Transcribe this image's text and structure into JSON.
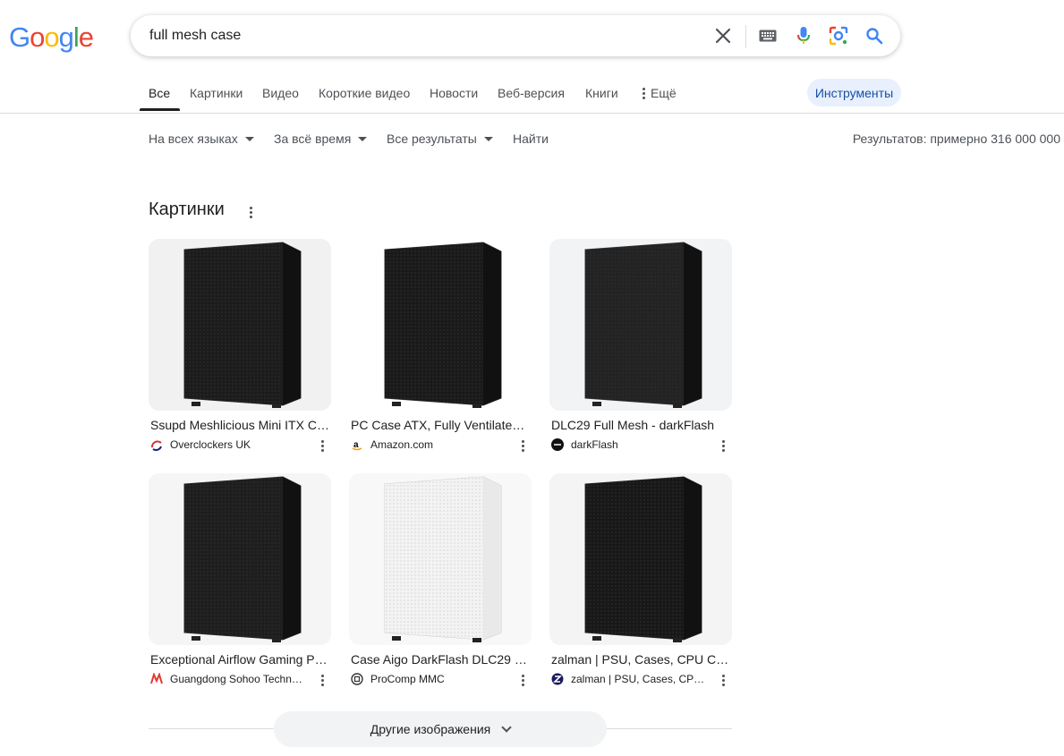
{
  "logo": {
    "letters": [
      "G",
      "o",
      "o",
      "g",
      "l",
      "e"
    ],
    "colors": [
      "#4285f4",
      "#ea4335",
      "#fbbc05",
      "#4285f4",
      "#34a853",
      "#ea4335"
    ]
  },
  "search": {
    "query": "full mesh case",
    "icons": [
      "clear-icon",
      "keyboard-icon",
      "microphone-icon",
      "lens-icon",
      "search-icon"
    ]
  },
  "tabs": [
    "Все",
    "Картинки",
    "Видео",
    "Короткие видео",
    "Новости",
    "Веб-версия",
    "Книги",
    "Ещё"
  ],
  "tools_label": "Инструменты",
  "filters": {
    "language": "На всех языках",
    "time": "За всё время",
    "results": "Все результаты",
    "find": "Найти"
  },
  "result_stats": "Результатов: примерно 316 000 000",
  "images_section": {
    "title": "Картинки",
    "items": [
      {
        "title": "Ssupd Meshlicious Mini ITX Case ...",
        "source": "Overclockers UK",
        "icon": "overclockers-favicon",
        "case_color": "#1c1c1c",
        "bg": "#f1f1f1"
      },
      {
        "title": "PC Case ATX, Fully Ventilated Mesh ...",
        "source": "Amazon.com",
        "icon": "amazon-favicon",
        "case_color": "#1a1a1a",
        "bg": "#ffffff"
      },
      {
        "title": "DLC29 Full Mesh - darkFlash",
        "source": "darkFlash",
        "icon": "darkflash-favicon",
        "case_color": "#232323",
        "bg": "#f1f3f4"
      },
      {
        "title": "Exceptional Airflow Gaming PC Case ...",
        "source": "Guangdong Sohoo Technology ...",
        "icon": "sohoo-favicon",
        "case_color": "#1e1e1e",
        "bg": "#f5f5f5"
      },
      {
        "title": "Case Aigo DarkFlash DLC29 Full Mesh ...",
        "source": "ProComp MMC",
        "icon": "procomp-favicon",
        "case_color": "#f3f3f3",
        "bg": "#f8f8f8"
      },
      {
        "title": "zalman | PSU, Cases, CPU Coolers ...",
        "source": "zalman | PSU, Cases, CPU ...",
        "icon": "zalman-favicon",
        "case_color": "#181818",
        "bg": "#f4f4f4"
      }
    ]
  },
  "more_images_label": "Другие изображения"
}
